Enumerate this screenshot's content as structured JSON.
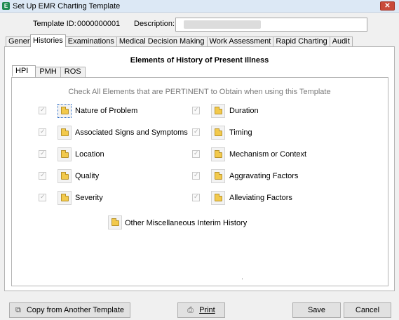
{
  "window": {
    "title": "Set Up EMR Charting Template",
    "app_icon": "emr-app-icon",
    "close_icon": "close-icon"
  },
  "header": {
    "template_id_label": "Template ID:",
    "template_id_value": "0000000001",
    "description_label": "Description:",
    "description_value": ""
  },
  "tabs": [
    {
      "label": "General"
    },
    {
      "label": "Histories"
    },
    {
      "label": "Examinations"
    },
    {
      "label": "Medical Decision Making"
    },
    {
      "label": "Work Assessment"
    },
    {
      "label": "Rapid Charting"
    },
    {
      "label": "Audit"
    }
  ],
  "active_tab": "Histories",
  "section": {
    "heading": "Elements of History of Present Illness"
  },
  "subtabs": [
    {
      "label": "HPI"
    },
    {
      "label": "PMH"
    },
    {
      "label": "ROS"
    }
  ],
  "active_subtab": "HPI",
  "instruction": "Check All Elements that are PERTINENT to Obtain when using this Template",
  "elements_left": [
    {
      "label": "Nature of Problem",
      "checked": true
    },
    {
      "label": "Associated Signs and Symptoms",
      "checked": true
    },
    {
      "label": "Location",
      "checked": true
    },
    {
      "label": "Quality",
      "checked": true
    },
    {
      "label": "Severity",
      "checked": true
    }
  ],
  "elements_right": [
    {
      "label": "Duration",
      "checked": true
    },
    {
      "label": "Timing",
      "checked": true
    },
    {
      "label": "Mechanism or Context",
      "checked": true
    },
    {
      "label": "Aggravating Factors",
      "checked": true
    },
    {
      "label": "Alleviating Factors",
      "checked": true
    }
  ],
  "other_element": {
    "label": "Other Miscellaneous Interim History"
  },
  "buttons": {
    "copy": "Copy from Another Template",
    "print": "Print",
    "save": "Save",
    "cancel": "Cancel"
  },
  "colors": {
    "title_bar": "#dce8f5",
    "close_button": "#c94a3a",
    "app_icon": "#1e8a52",
    "folder_icon": "#f2c94c"
  }
}
